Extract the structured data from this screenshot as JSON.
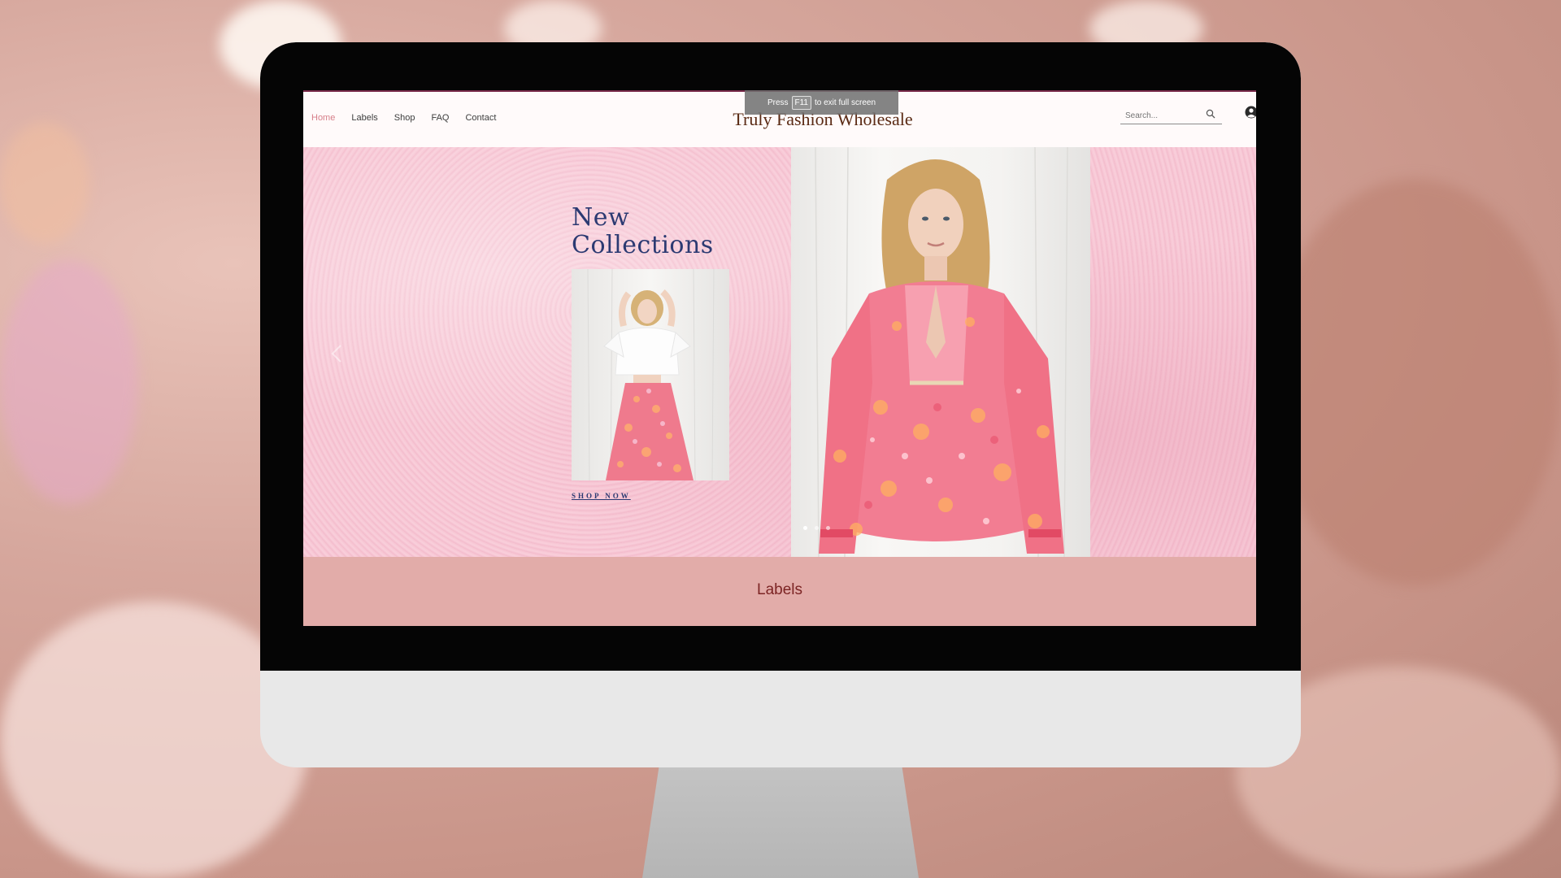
{
  "window": {
    "fullscreen_notice": {
      "prefix": "Press",
      "key": "F11",
      "suffix": "to exit full screen"
    }
  },
  "header": {
    "nav": [
      {
        "label": "Home",
        "active": true
      },
      {
        "label": "Labels",
        "active": false
      },
      {
        "label": "Shop",
        "active": false
      },
      {
        "label": "FAQ",
        "active": false
      },
      {
        "label": "Contact",
        "active": false
      }
    ],
    "brand": "Truly Fashion Wholesale",
    "search": {
      "placeholder": "Search..."
    },
    "icons": {
      "search": "search-icon",
      "user": "user-icon"
    }
  },
  "hero": {
    "title_line1": "New",
    "title_line2": "Collections",
    "cta": "SHOP NOW",
    "slider_dots": [
      true,
      false,
      false
    ]
  },
  "labels_section": {
    "title": "Labels"
  },
  "colors": {
    "accent_nav": "#d77f8a",
    "brand_text": "#5a2a14",
    "hero_title": "#2c3a72",
    "labels_band": "#e2aca9",
    "labels_text": "#7c2424"
  }
}
